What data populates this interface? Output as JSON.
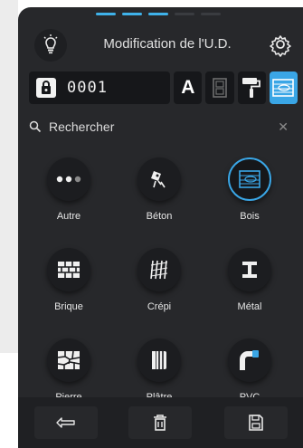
{
  "header": {
    "title": "Modification de l'U.D."
  },
  "device": {
    "code": "0001",
    "label_letter": "A"
  },
  "search": {
    "label": "Rechercher"
  },
  "materials": [
    {
      "label": "Autre",
      "icon": "dots-icon"
    },
    {
      "label": "Béton",
      "icon": "concrete-drill-icon"
    },
    {
      "label": "Bois",
      "icon": "wood-icon",
      "selected": true
    },
    {
      "label": "Brique",
      "icon": "brick-icon"
    },
    {
      "label": "Crépi",
      "icon": "render-icon"
    },
    {
      "label": "Métal",
      "icon": "metal-beam-icon"
    },
    {
      "label": "Pierre",
      "icon": "stone-icon"
    },
    {
      "label": "Plâtre",
      "icon": "plaster-icon"
    },
    {
      "label": "PVC",
      "icon": "pvc-pipe-icon"
    }
  ],
  "colors": {
    "accent": "#3aa6e6",
    "panel": "#27282b"
  }
}
